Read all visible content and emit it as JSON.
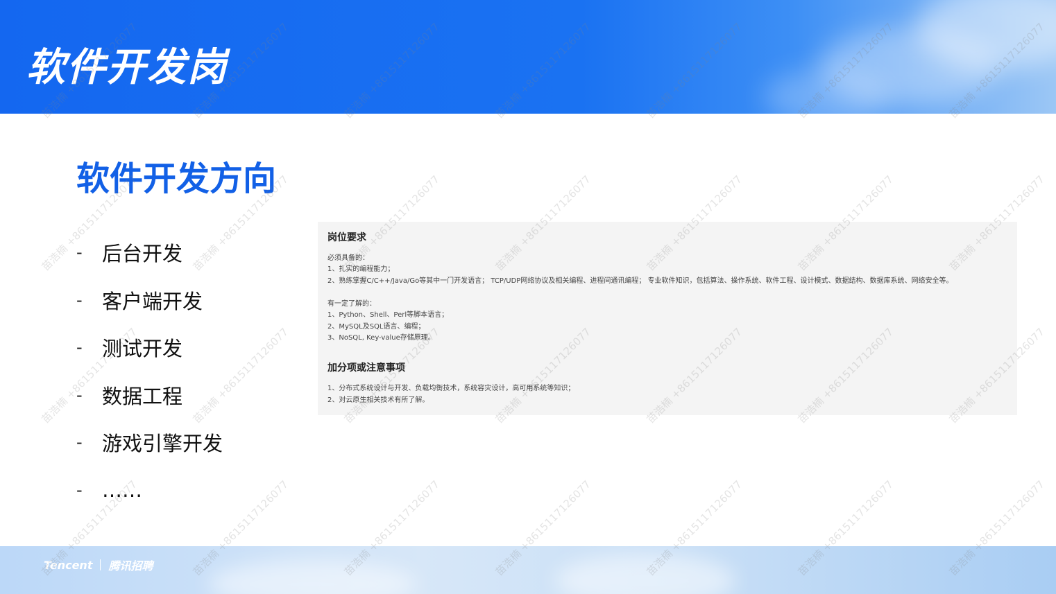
{
  "header": {
    "title": "软件开发岗"
  },
  "section": {
    "title": "软件开发方向"
  },
  "directions": {
    "dash": "-",
    "items": [
      "后台开发",
      "客户端开发",
      "测试开发",
      "数据工程",
      "游戏引擎开发",
      "……"
    ]
  },
  "requirements": {
    "heading": "岗位要求",
    "must_label": "必须具备的：",
    "must_1": "1、扎实的编程能力；",
    "must_2": "2、熟练掌握C/C++/Java/Go等其中一门开发语言； TCP/UDP网络协议及相关编程、进程间通讯编程； 专业软件知识，包括算法、操作系统、软件工程、设计模式、数据结构、数据库系统、网络安全等。",
    "know_label": "有一定了解的：",
    "know_1": "1、Python、Shell、Perl等脚本语言；",
    "know_2": "2、MySQL及SQL语言、编程；",
    "know_3": "3、NoSQL, Key-value存储原理。"
  },
  "bonus": {
    "heading": "加分项或注意事项",
    "line_1": "1、分布式系统设计与开发、负载均衡技术，系统容灾设计，高可用系统等知识；",
    "line_2": "2、对云原生相关技术有所了解。"
  },
  "footer": {
    "brand": "Tencent",
    "recruit": "腾讯招聘"
  },
  "watermark": {
    "text": "苗浩楠 +8615117126077"
  },
  "colors": {
    "header_blue": "#1467f0",
    "title_blue": "#1260e6",
    "box_bg": "#f4f4f4"
  }
}
